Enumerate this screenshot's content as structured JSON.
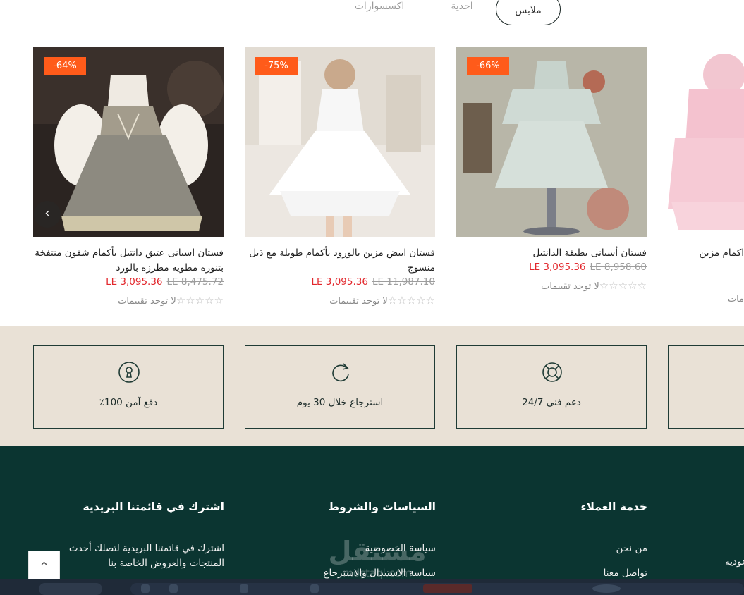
{
  "tabs": [
    {
      "label": "اكسسوارات"
    },
    {
      "label": "احذية"
    },
    {
      "label": "ملابس"
    }
  ],
  "products": [
    {
      "badge": "-64%",
      "title": "فستان اسبانى عتيق دانتيل بأكمام شفون منتفخة بتنوره مطويه مطرزه بالورد",
      "price_new": "LE 3,095.36",
      "price_old": "LE 8,475.72",
      "rating_text": "لا توجد تقييمات",
      "stars": "☆☆☆☆☆"
    },
    {
      "badge": "-75%",
      "title": "فستان ابيض مزين بالورود بأكمام طويلة مع ذيل منسوج",
      "price_new": "LE 3,095.36",
      "price_old": "LE 11,987.10",
      "rating_text": "لا توجد تقييمات",
      "stars": "☆☆☆☆☆"
    },
    {
      "badge": "-66%",
      "title": "فستان أسبانى بطبقة الدانتيل",
      "price_new": "LE 3,095.36",
      "price_old": "LE 8,958.60",
      "rating_text": "لا توجد تقييمات",
      "stars": "☆☆☆☆☆"
    },
    {
      "title": "اكمام مزين",
      "rating_text": "مات"
    }
  ],
  "features": [
    {
      "label": "دفع آمن 100٪",
      "icon": "keyhole-icon"
    },
    {
      "label": "استرجاع خلال 30 يوم",
      "icon": "refresh-icon"
    },
    {
      "label": "دعم فنى 24/7",
      "icon": "lifebuoy-icon"
    }
  ],
  "footer": {
    "newsletter": {
      "heading": "اشترك في قائمتنا البريدية",
      "text": "اشترك في قائمتنا البريدية لتصلك أحدث المنتجات والعروض الخاصة بنا"
    },
    "policies": {
      "heading": "السياسات والشروط",
      "links": [
        "سياسة الخصوصية",
        "سياسة الاستبدال والاسترجاع"
      ]
    },
    "service": {
      "heading": "خدمة العملاء",
      "links": [
        "من نحن",
        "تواصل معنا"
      ]
    },
    "edge_text": "عودية"
  },
  "watermark": {
    "logo_text": "مستقل",
    "domain": "mostaql.com"
  },
  "colors": {
    "badge": "#ff5b1a",
    "price_new": "#e2272c",
    "footer_bg": "#0b3531",
    "features_bg": "#e9e1d6"
  }
}
